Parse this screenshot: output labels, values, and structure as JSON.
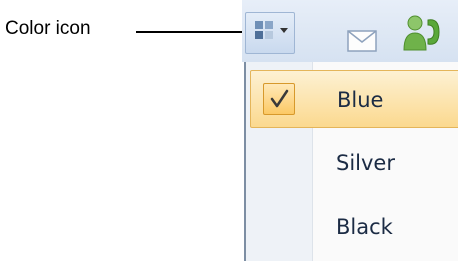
{
  "annotation": {
    "label": "Color icon"
  },
  "toolbar": {
    "icons": [
      "color-grid-icon",
      "dropdown-arrow-icon",
      "mail-icon",
      "phone-contact-icon"
    ]
  },
  "menu": {
    "items": [
      {
        "label": "Blue",
        "checked": true
      },
      {
        "label": "Silver",
        "checked": false
      },
      {
        "label": "Black",
        "checked": false
      }
    ]
  },
  "colors": {
    "toolbar_bg": "#d6e2f1",
    "selected_item_bg": "#fbd98f",
    "selected_item_border": "#e4b55a",
    "menu_text": "#1b2b44",
    "phone_icon": "#5aa83a"
  }
}
